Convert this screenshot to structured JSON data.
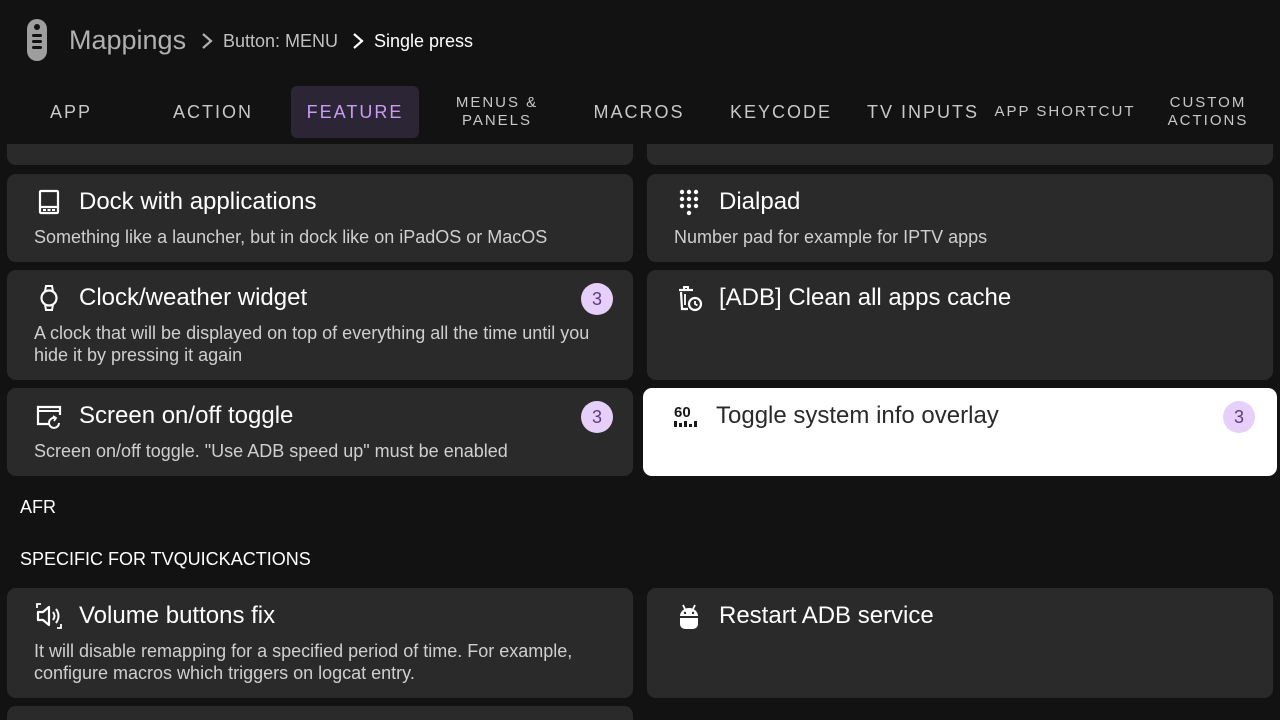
{
  "header": {
    "breadcrumb_root": "Mappings",
    "breadcrumb_mid": "Button: MENU",
    "breadcrumb_current": "Single press"
  },
  "tabs": [
    {
      "label": "APP"
    },
    {
      "label": "ACTION"
    },
    {
      "label": "FEATURE",
      "active": true
    },
    {
      "label": "MENUS & PANELS"
    },
    {
      "label": "MACROS"
    },
    {
      "label": "KEYCODE"
    },
    {
      "label": "TV INPUTS"
    },
    {
      "label": "APP SHORTCUT"
    },
    {
      "label": "CUSTOM ACTIONS"
    }
  ],
  "cards": {
    "dock": {
      "title": "Dock with applications",
      "desc": "Something like a launcher, but in dock like on iPadOS or MacOS",
      "icon": "dock-icon"
    },
    "dialpad": {
      "title": "Dialpad",
      "desc": "Number pad for example for IPTV apps",
      "icon": "dialpad-icon"
    },
    "clock": {
      "title": "Clock/weather widget",
      "desc": "A clock that will be displayed on top of everything all the time until you hide it by pressing it again",
      "badge": "3",
      "icon": "watch-icon"
    },
    "adb_cache": {
      "title": "[ADB] Clean all apps cache",
      "icon": "clean-cache-icon"
    },
    "screen_toggle": {
      "title": "Screen on/off toggle",
      "desc": "Screen on/off toggle. \"Use ADB speed up\" must be enabled",
      "badge": "3",
      "icon": "screen-toggle-icon"
    },
    "sysinfo": {
      "title": "Toggle system info overlay",
      "badge": "3",
      "icon": "fps-overlay-icon"
    },
    "volume_fix": {
      "title": "Volume buttons fix",
      "desc": "It will disable remapping for a specified period of time. For example, configure macros which triggers on logcat entry.",
      "icon": "volume-icon"
    },
    "restart_adb": {
      "title": "Restart ADB service",
      "icon": "android-icon"
    }
  },
  "sections": {
    "afr": "AFR",
    "specific": "SPECIFIC FOR TVQUICKACTIONS"
  },
  "colors": {
    "background": "#121212",
    "card": "#2a2a2a",
    "accent": "#c89ef2",
    "badge": "#e6d0fa"
  }
}
